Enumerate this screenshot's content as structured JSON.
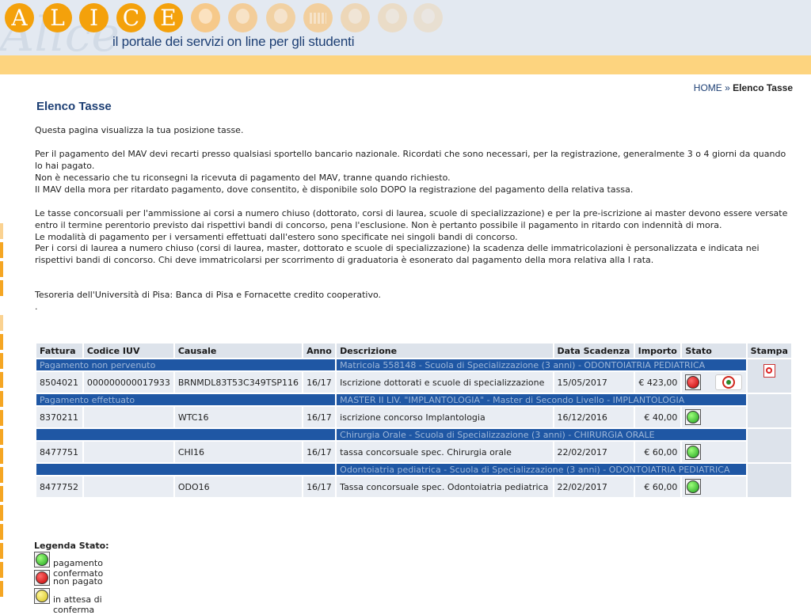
{
  "header": {
    "logo_letters": [
      "A",
      "L",
      "I",
      "C",
      "E"
    ],
    "logo_script": "Alice",
    "tagline": "il portale dei servizi on line per gli studenti"
  },
  "breadcrumb": {
    "home": "HOME",
    "separator": "»",
    "current": "Elenco Tasse"
  },
  "page_title": "Elenco Tasse",
  "paragraphs": [
    "Questa pagina visualizza la tua posizione tasse.",
    "Per il pagamento del MAV devi recarti presso qualsiasi sportello bancario nazionale. Ricordati che sono necessari, per la registrazione, generalmente 3 o 4 giorni da quando lo hai pagato.",
    "Non è necessario che tu riconsegni la ricevuta di pagamento del MAV, tranne quando richiesto.",
    "Il MAV della mora per ritardato pagamento, dove consentito, è disponibile solo DOPO la registrazione del pagamento della relativa tassa.",
    "Le tasse concorsuali per l'ammissione ai corsi a numero chiuso (dottorato, corsi di laurea, scuole di specializzazione) e per la pre-iscrizione ai master devono essere versate entro il termine perentorio previsto dai rispettivi bandi di concorso, pena l'esclusione. Non è pertanto possibile il pagamento in ritardo con indennità di mora.",
    "Le modalità di pagamento per i versamenti effettuati dall'estero sono specificate nei singoli bandi di concorso.",
    "Per i corsi di laurea a numero chiuso (corsi di laurea, master, dottorato e scuole di specializzazione) la scadenza delle immatricolazioni è personalizzata e indicata nei rispettivi bandi di concorso. Chi deve immatricolarsi per scorrimento di graduatoria è esonerato dal pagamento della mora relativa alla I rata.",
    "Tesoreria dell'Università di Pisa: Banca di Pisa e Fornacette credito cooperativo.",
    "."
  ],
  "table": {
    "headers": [
      "Fattura",
      "Codice IUV",
      "Causale",
      "Anno",
      "Descrizione",
      "Data Scadenza",
      "Importo",
      "Stato",
      "Stampa"
    ],
    "groups": [
      {
        "left_label": "Pagamento non pervenuto",
        "right_label": "Matricola 558148 - Scuola di Specializzazione (3 anni) - ODONTOIATRIA PEDIATRICA",
        "rows": [
          {
            "fattura": "8504021",
            "iuv": "000000000017933",
            "causale": "BRNMDL83T53C349TSP116",
            "anno": "16/17",
            "descrizione": "Iscrizione dottorati e scuole di specializzazione",
            "scadenza": "15/05/2017",
            "importo": "€ 423,00",
            "stato": "non pagato",
            "pay_button": true,
            "stampa": true
          }
        ]
      },
      {
        "left_label": "Pagamento effettuato",
        "right_label": "MASTER II LIV. \"IMPLANTOLOGIA\" - Master di Secondo Livello - IMPLANTOLOGIA",
        "rows": [
          {
            "fattura": "8370211",
            "iuv": "",
            "causale": "WTC16",
            "anno": "16/17",
            "descrizione": "iscrizione concorso Implantologia",
            "scadenza": "16/12/2016",
            "importo": "€ 40,00",
            "stato": "pagamento confermato",
            "pay_button": false,
            "stampa": false
          }
        ]
      },
      {
        "left_label": "",
        "right_label": "Chirurgia Orale - Scuola di Specializzazione (3 anni) - CHIRURGIA ORALE",
        "rows": [
          {
            "fattura": "8477751",
            "iuv": "",
            "causale": "CHI16",
            "anno": "16/17",
            "descrizione": "tassa concorsuale spec. Chirurgia orale",
            "scadenza": "22/02/2017",
            "importo": "€ 60,00",
            "stato": "pagamento confermato",
            "pay_button": false,
            "stampa": false
          }
        ]
      },
      {
        "left_label": "",
        "right_label": "Odontoiatria pediatrica - Scuola di Specializzazione (3 anni) - ODONTOIATRIA PEDIATRICA",
        "rows": [
          {
            "fattura": "8477752",
            "iuv": "",
            "causale": "ODO16",
            "anno": "16/17",
            "descrizione": "Tassa concorsuale spec. Odontoiatria pediatrica",
            "scadenza": "22/02/2017",
            "importo": "€ 60,00",
            "stato": "pagamento confermato",
            "pay_button": false,
            "stampa": false
          }
        ]
      }
    ]
  },
  "legend": {
    "title": "Legenda Stato:",
    "items": [
      {
        "color": "green",
        "label": "pagamento confermato"
      },
      {
        "color": "red",
        "label": "non pagato"
      },
      {
        "color": "yellow",
        "label": "in attesa di conferma"
      }
    ]
  },
  "colors": {
    "accent_orange": "#f4a10b",
    "band_blue": "#1f57a4",
    "title_blue": "#1d3f74"
  }
}
